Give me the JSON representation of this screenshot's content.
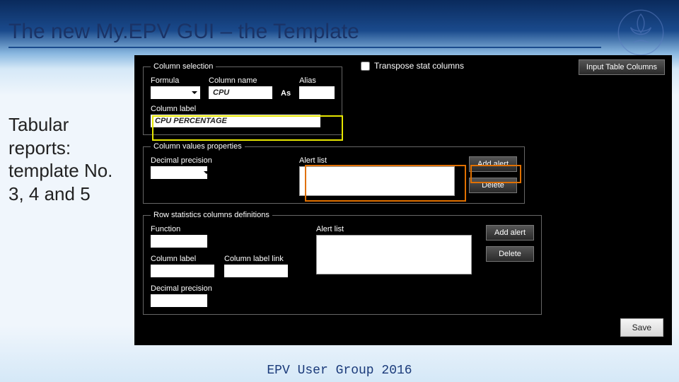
{
  "slide": {
    "title": "The new My.EPV GUI – the Template",
    "side_text": "Tabular reports: template No. 3, 4 and 5",
    "footer": "EPV User Group 2016"
  },
  "panel": {
    "transpose": {
      "label": "Transpose stat columns",
      "checked": false
    },
    "input_table_btn": "Input Table Columns",
    "save_btn": "Save",
    "column_selection": {
      "legend": "Column selection",
      "formula_label": "Formula",
      "formula_value": "",
      "column_name_label": "Column name",
      "column_name_value": "CPU",
      "as_label": "As",
      "alias_label": "Alias",
      "alias_value": "",
      "column_label_label": "Column label",
      "column_label_value": "CPU PERCENTAGE"
    },
    "column_values": {
      "legend": "Column values properties",
      "decimal_label": "Decimal precision",
      "decimal_value": "",
      "alert_list_label": "Alert list",
      "add_alert_btn": "Add alert",
      "delete_btn": "Delete"
    },
    "row_stats": {
      "legend": "Row statistics columns definitions",
      "function_label": "Function",
      "function_value": "",
      "alert_list_label": "Alert list",
      "add_alert_btn": "Add alert",
      "delete_btn": "Delete",
      "column_label_label": "Column label",
      "column_label_value": "",
      "column_label_link_label": "Column label link",
      "column_label_link_value": "",
      "decimal_label": "Decimal precision",
      "decimal_value": ""
    }
  }
}
